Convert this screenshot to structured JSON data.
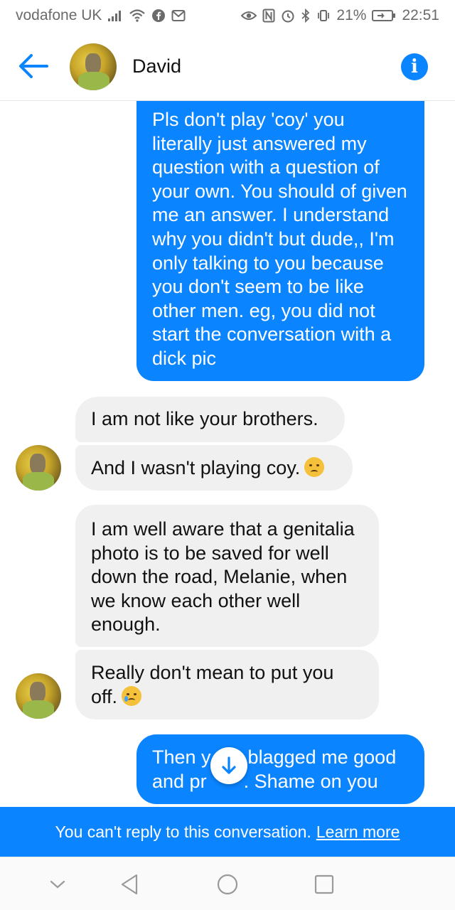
{
  "status_bar": {
    "carrier": "vodafone UK",
    "battery": "21%",
    "time": "22:51"
  },
  "header": {
    "contact_name": "David",
    "info_glyph": "i",
    "back_icon": "arrow-left-icon"
  },
  "messages": [
    {
      "direction": "outgoing",
      "text": "Pls don't play 'coy' you literally just answered my question with a question of your own. You should of given me an answer. I understand why you didn't but dude,, I'm only talking to you because you don't seem to be like other men. eg, you did not start the conversation with a dick pic"
    },
    {
      "direction": "incoming",
      "text": "I am not like your brothers."
    },
    {
      "direction": "incoming",
      "text": "And I wasn't playing coy.",
      "emoji": "disappointed-face"
    },
    {
      "direction": "incoming",
      "text": "I am well aware that a genitalia photo is to be saved for well down the road, Melanie, when we know each other well enough."
    },
    {
      "direction": "incoming",
      "text": "Really don't mean to put you off.",
      "emoji": "crying-face"
    },
    {
      "direction": "outgoing",
      "text_part1": "Then y",
      "text_part2": "blagged me good",
      "text_part3": "and pr",
      "text_part4": ". Shame on you"
    }
  ],
  "banner": {
    "text": "You can't reply to this conversation.",
    "link": "Learn more"
  },
  "colors": {
    "accent": "#0a84ff",
    "incoming_bubble": "#f0f0f0",
    "text_dark": "#111111"
  }
}
